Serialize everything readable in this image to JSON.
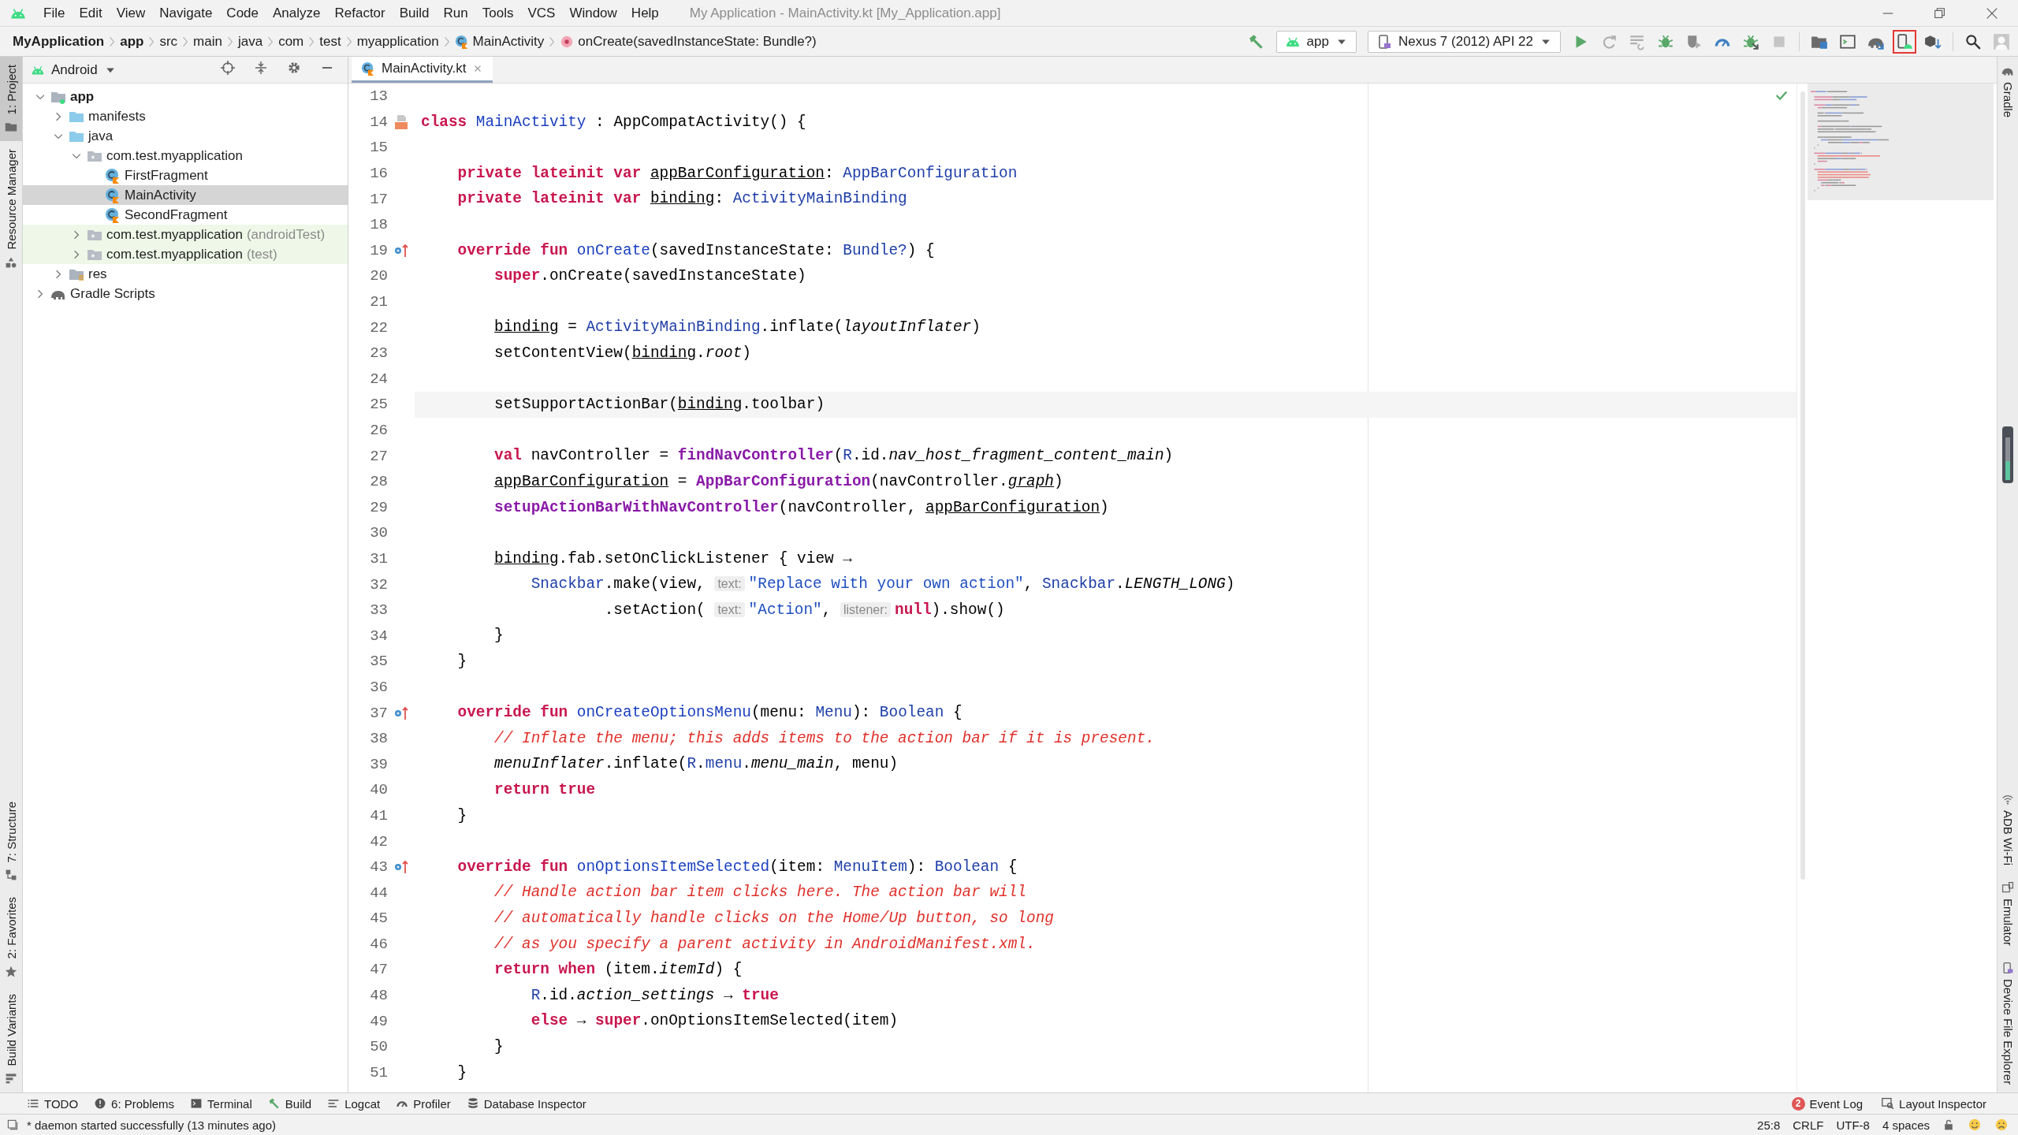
{
  "window": {
    "title": "My Application - MainActivity.kt [My_Application.app]"
  },
  "menu": [
    "File",
    "Edit",
    "View",
    "Navigate",
    "Code",
    "Analyze",
    "Refactor",
    "Build",
    "Run",
    "Tools",
    "VCS",
    "Window",
    "Help"
  ],
  "breadcrumbs": [
    {
      "label": "MyApplication",
      "kind": "project"
    },
    {
      "label": "app",
      "kind": "module"
    },
    {
      "label": "src",
      "kind": "dir"
    },
    {
      "label": "main",
      "kind": "dir"
    },
    {
      "label": "java",
      "kind": "dir"
    },
    {
      "label": "com",
      "kind": "dir"
    },
    {
      "label": "test",
      "kind": "dir"
    },
    {
      "label": "myapplication",
      "kind": "dir"
    },
    {
      "label": "MainActivity",
      "kind": "class"
    },
    {
      "label": "onCreate(savedInstanceState: Bundle?)",
      "kind": "method"
    }
  ],
  "toolbar": [
    {
      "kind": "build",
      "highlighted": false
    },
    {
      "kind": "run-config",
      "label": "app"
    },
    {
      "kind": "device",
      "label": "Nexus 7 (2012) API 22"
    },
    {
      "kind": "run",
      "highlighted": false
    },
    {
      "kind": "apply-changes",
      "highlighted": false
    },
    {
      "kind": "apply-code",
      "highlighted": false
    },
    {
      "kind": "debug",
      "highlighted": false
    },
    {
      "kind": "coverage",
      "highlighted": false
    },
    {
      "kind": "profile",
      "highlighted": false
    },
    {
      "kind": "attach",
      "highlighted": false
    },
    {
      "kind": "stop",
      "highlighted": false
    },
    {
      "kind": "project-structure",
      "highlighted": false
    },
    {
      "kind": "run-window",
      "highlighted": false
    },
    {
      "kind": "sync",
      "highlighted": false
    },
    {
      "kind": "avd",
      "highlighted": true
    },
    {
      "kind": "sdk",
      "highlighted": false
    },
    {
      "kind": "search",
      "highlighted": false
    },
    {
      "kind": "avatar",
      "highlighted": false
    }
  ],
  "left_stripe": {
    "top": [
      {
        "label": "1: Project",
        "kind": "project",
        "selected": true
      },
      {
        "label": "Resource Manager",
        "kind": "resources",
        "selected": false
      }
    ],
    "bottom": [
      {
        "label": "7: Structure",
        "kind": "structure",
        "selected": false
      },
      {
        "label": "2: Favorites",
        "kind": "favorites",
        "selected": false
      },
      {
        "label": "Build Variants",
        "kind": "variants",
        "selected": false
      }
    ]
  },
  "right_stripe": {
    "top": [
      {
        "label": "Gradle",
        "kind": "gradle"
      }
    ],
    "bottom": [
      {
        "label": "ADB Wi-Fi",
        "kind": "wifi"
      },
      {
        "label": "Emulator",
        "kind": "emulator"
      },
      {
        "label": "Device File Explorer",
        "kind": "device"
      }
    ]
  },
  "project_panel": {
    "view": "Android",
    "tree": [
      {
        "label": "app",
        "kind": "module",
        "expanded": true,
        "selected": false,
        "children": [
          {
            "label": "manifests",
            "kind": "folder",
            "expanded": false,
            "selected": false
          },
          {
            "label": "java",
            "kind": "folder",
            "expanded": true,
            "selected": false,
            "children": [
              {
                "label": "com.test.myapplication",
                "kind": "package",
                "expanded": true,
                "selected": false,
                "children": [
                  {
                    "label": "FirstFragment",
                    "kind": "kotlin-class",
                    "selected": false
                  },
                  {
                    "label": "MainActivity",
                    "kind": "kotlin-class",
                    "selected": true
                  },
                  {
                    "label": "SecondFragment",
                    "kind": "kotlin-class",
                    "selected": false
                  }
                ]
              },
              {
                "label": "com.test.myapplication",
                "suffix": "(androidTest)",
                "kind": "test-package",
                "expanded": false,
                "selected": false
              },
              {
                "label": "com.test.myapplication",
                "suffix": "(test)",
                "kind": "test-package",
                "expanded": false,
                "selected": false
              }
            ]
          },
          {
            "label": "res",
            "kind": "res-folder",
            "expanded": false,
            "selected": false
          }
        ]
      },
      {
        "label": "Gradle Scripts",
        "kind": "gradle",
        "expanded": false,
        "selected": false
      }
    ]
  },
  "editor": {
    "tabs": [
      {
        "label": "MainActivity.kt",
        "selected": true
      }
    ],
    "lines": [
      {
        "number": "13",
        "current": false
      },
      {
        "number": "14",
        "current": false,
        "kind": "layout",
        "tokens": [
          {
            "kind": "kw",
            "text": "class "
          },
          {
            "kind": "name",
            "text": "MainActivity"
          },
          {
            "kind": "plain",
            "text": " : AppCompatActivity() {"
          }
        ]
      },
      {
        "number": "15",
        "current": false
      },
      {
        "number": "16",
        "current": false,
        "tokens": [
          {
            "kind": "kw",
            "text": "    private lateinit var "
          },
          {
            "kind": "prop",
            "text": "appBarConfiguration"
          },
          {
            "kind": "plain",
            "text": ": "
          },
          {
            "kind": "type",
            "text": "AppBarConfiguration"
          }
        ]
      },
      {
        "number": "17",
        "current": false,
        "tokens": [
          {
            "kind": "kw",
            "text": "    private lateinit var "
          },
          {
            "kind": "prop",
            "text": "binding"
          },
          {
            "kind": "plain",
            "text": ": "
          },
          {
            "kind": "type",
            "text": "ActivityMainBinding"
          }
        ]
      },
      {
        "number": "18",
        "current": false
      },
      {
        "number": "19",
        "current": false,
        "kind": "override",
        "tokens": [
          {
            "kind": "kw",
            "text": "    override fun "
          },
          {
            "kind": "name",
            "text": "onCreate"
          },
          {
            "kind": "plain",
            "text": "(savedInstanceState: "
          },
          {
            "kind": "type",
            "text": "Bundle?"
          },
          {
            "kind": "plain",
            "text": ") {"
          }
        ]
      },
      {
        "number": "20",
        "current": false,
        "tokens": [
          {
            "kind": "kw",
            "text": "        super"
          },
          {
            "kind": "plain",
            "text": ".onCreate(savedInstanceState)"
          }
        ]
      },
      {
        "number": "21",
        "current": false
      },
      {
        "number": "22",
        "current": false,
        "tokens": [
          {
            "kind": "prop",
            "text": "        binding"
          },
          {
            "kind": "plain",
            "text": " = "
          },
          {
            "kind": "type",
            "text": "ActivityMainBinding"
          },
          {
            "kind": "plain",
            "text": ".inflate("
          },
          {
            "kind": "ext",
            "text": "layoutInflater"
          },
          {
            "kind": "plain",
            "text": ")"
          }
        ]
      },
      {
        "number": "23",
        "current": false,
        "tokens": [
          {
            "kind": "plain",
            "text": "        setContentView("
          },
          {
            "kind": "prop",
            "text": "binding"
          },
          {
            "kind": "plain",
            "text": "."
          },
          {
            "kind": "ext",
            "text": "root"
          },
          {
            "kind": "plain",
            "text": ")"
          }
        ]
      },
      {
        "number": "24",
        "current": false
      },
      {
        "number": "25",
        "current": true,
        "tokens": [
          {
            "kind": "plain",
            "text": "        setSupportActionBar("
          },
          {
            "kind": "prop",
            "text": "binding"
          },
          {
            "kind": "plain",
            "text": ".toolbar)"
          }
        ]
      },
      {
        "number": "26",
        "current": false
      },
      {
        "number": "27",
        "current": false,
        "tokens": [
          {
            "kind": "kw",
            "text": "        val "
          },
          {
            "kind": "plain",
            "text": "navController = "
          },
          {
            "kind": "call",
            "text": "findNavController"
          },
          {
            "kind": "plain",
            "text": "("
          },
          {
            "kind": "type",
            "text": "R"
          },
          {
            "kind": "plain",
            "text": ".id."
          },
          {
            "kind": "ext",
            "text": "nav_host_fragment_content_main"
          },
          {
            "kind": "plain",
            "text": ")"
          }
        ]
      },
      {
        "number": "28",
        "current": false,
        "tokens": [
          {
            "kind": "prop",
            "text": "        appBarConfiguration"
          },
          {
            "kind": "plain",
            "text": " = "
          },
          {
            "kind": "call",
            "text": "AppBarConfiguration"
          },
          {
            "kind": "plain",
            "text": "(navController."
          },
          {
            "kind": "extu",
            "text": "graph"
          },
          {
            "kind": "plain",
            "text": ")"
          }
        ]
      },
      {
        "number": "29",
        "current": false,
        "tokens": [
          {
            "kind": "call",
            "text": "        setupActionBarWithNavController"
          },
          {
            "kind": "plain",
            "text": "(navController, "
          },
          {
            "kind": "prop",
            "text": "appBarConfiguration"
          },
          {
            "kind": "plain",
            "text": ")"
          }
        ]
      },
      {
        "number": "30",
        "current": false
      },
      {
        "number": "31",
        "current": false,
        "tokens": [
          {
            "kind": "prop",
            "text": "        binding"
          },
          {
            "kind": "plain",
            "text": ".fab.setOnClickListener { view "
          },
          {
            "kind": "arrow",
            "text": "→"
          }
        ]
      },
      {
        "number": "32",
        "current": false,
        "tokens": [
          {
            "kind": "type",
            "text": "            Snackbar"
          },
          {
            "kind": "plain",
            "text": ".make(view, "
          },
          {
            "kind": "hint",
            "text": "text:"
          },
          {
            "kind": "string",
            "text": "\"Replace with your own action\""
          },
          {
            "kind": "plain",
            "text": ", "
          },
          {
            "kind": "type",
            "text": "Snackbar"
          },
          {
            "kind": "plain",
            "text": "."
          },
          {
            "kind": "ext",
            "text": "LENGTH_LONG"
          },
          {
            "kind": "plain",
            "text": ")"
          }
        ]
      },
      {
        "number": "33",
        "current": false,
        "tokens": [
          {
            "kind": "plain",
            "text": "                    .setAction( "
          },
          {
            "kind": "hint",
            "text": "text:"
          },
          {
            "kind": "string",
            "text": "\"Action\""
          },
          {
            "kind": "plain",
            "text": ", "
          },
          {
            "kind": "hint",
            "text": "listener:"
          },
          {
            "kind": "kw",
            "text": "null"
          },
          {
            "kind": "plain",
            "text": ").show()"
          }
        ]
      },
      {
        "number": "34",
        "current": false,
        "tokens": [
          {
            "kind": "plain",
            "text": "        }"
          }
        ]
      },
      {
        "number": "35",
        "current": false,
        "tokens": [
          {
            "kind": "plain",
            "text": "    }"
          }
        ]
      },
      {
        "number": "36",
        "current": false
      },
      {
        "number": "37",
        "current": false,
        "kind": "override",
        "tokens": [
          {
            "kind": "kw",
            "text": "    override fun "
          },
          {
            "kind": "name",
            "text": "onCreateOptionsMenu"
          },
          {
            "kind": "plain",
            "text": "(menu: "
          },
          {
            "kind": "type",
            "text": "Menu"
          },
          {
            "kind": "plain",
            "text": "): "
          },
          {
            "kind": "type",
            "text": "Boolean"
          },
          {
            "kind": "plain",
            "text": " {"
          }
        ]
      },
      {
        "number": "38",
        "current": false,
        "tokens": [
          {
            "kind": "comment",
            "text": "        // Inflate the menu; this adds items to the action bar if it is present."
          }
        ]
      },
      {
        "number": "39",
        "current": false,
        "tokens": [
          {
            "kind": "ext",
            "text": "        menuInflater"
          },
          {
            "kind": "plain",
            "text": ".inflate("
          },
          {
            "kind": "type",
            "text": "R"
          },
          {
            "kind": "plain",
            "text": "."
          },
          {
            "kind": "type",
            "text": "menu"
          },
          {
            "kind": "plain",
            "text": "."
          },
          {
            "kind": "ext",
            "text": "menu_main"
          },
          {
            "kind": "plain",
            "text": ", menu)"
          }
        ]
      },
      {
        "number": "40",
        "current": false,
        "tokens": [
          {
            "kind": "kw",
            "text": "        return true"
          }
        ]
      },
      {
        "number": "41",
        "current": false,
        "tokens": [
          {
            "kind": "plain",
            "text": "    }"
          }
        ]
      },
      {
        "number": "42",
        "current": false
      },
      {
        "number": "43",
        "current": false,
        "kind": "override",
        "tokens": [
          {
            "kind": "kw",
            "text": "    override fun "
          },
          {
            "kind": "name",
            "text": "onOptionsItemSelected"
          },
          {
            "kind": "plain",
            "text": "(item: "
          },
          {
            "kind": "type",
            "text": "MenuItem"
          },
          {
            "kind": "plain",
            "text": "): "
          },
          {
            "kind": "type",
            "text": "Boolean"
          },
          {
            "kind": "plain",
            "text": " {"
          }
        ]
      },
      {
        "number": "44",
        "current": false,
        "tokens": [
          {
            "kind": "comment",
            "text": "        // Handle action bar item clicks here. The action bar will"
          }
        ]
      },
      {
        "number": "45",
        "current": false,
        "tokens": [
          {
            "kind": "comment",
            "text": "        // automatically handle clicks on the Home/Up button, so long"
          }
        ]
      },
      {
        "number": "46",
        "current": false,
        "tokens": [
          {
            "kind": "comment",
            "text": "        // as you specify a parent activity in AndroidManifest.xml."
          }
        ]
      },
      {
        "number": "47",
        "current": false,
        "tokens": [
          {
            "kind": "kw",
            "text": "        return when "
          },
          {
            "kind": "plain",
            "text": "(item."
          },
          {
            "kind": "ext",
            "text": "itemId"
          },
          {
            "kind": "plain",
            "text": ") {"
          }
        ]
      },
      {
        "number": "48",
        "current": false,
        "tokens": [
          {
            "kind": "type",
            "text": "            R"
          },
          {
            "kind": "plain",
            "text": ".id."
          },
          {
            "kind": "ext",
            "text": "action_settings"
          },
          {
            "kind": "arrow",
            "text": " → "
          },
          {
            "kind": "kw",
            "text": "true"
          }
        ]
      },
      {
        "number": "49",
        "current": false,
        "tokens": [
          {
            "kind": "kw",
            "text": "            else"
          },
          {
            "kind": "arrow",
            "text": " → "
          },
          {
            "kind": "kw",
            "text": "super"
          },
          {
            "kind": "plain",
            "text": ".onOptionsItemSelected(item)"
          }
        ]
      },
      {
        "number": "50",
        "current": false,
        "tokens": [
          {
            "kind": "plain",
            "text": "        }"
          }
        ]
      },
      {
        "number": "51",
        "current": false,
        "tokens": [
          {
            "kind": "plain",
            "text": "    }"
          }
        ]
      }
    ]
  },
  "bottom_tools": [
    {
      "label": "TODO",
      "kind": "todo"
    },
    {
      "label": "6: Problems",
      "kind": "problems"
    },
    {
      "label": "Terminal",
      "kind": "terminal"
    },
    {
      "label": "Build",
      "kind": "build"
    },
    {
      "label": "Logcat",
      "kind": "logcat"
    },
    {
      "label": "Profiler",
      "kind": "profiler"
    },
    {
      "label": "Database Inspector",
      "kind": "database"
    }
  ],
  "bottom_tools_right": [
    {
      "label": "Event Log",
      "kind": "event-log",
      "badge": "2"
    },
    {
      "label": "Layout Inspector",
      "kind": "layout-inspector"
    }
  ],
  "status_bar": {
    "message": "* daemon started successfully (13 minutes ago)",
    "items": [
      "25:8",
      "CRLF",
      "UTF-8",
      "4 spaces"
    ]
  }
}
